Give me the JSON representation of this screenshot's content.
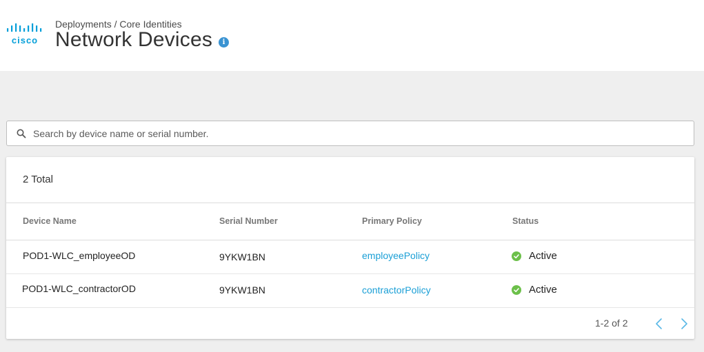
{
  "header": {
    "logo_text": "cisco",
    "breadcrumb": "Deployments / Core Identities",
    "title": "Network Devices",
    "info_glyph": "i"
  },
  "search": {
    "placeholder": "Search by device name or serial number.",
    "value": ""
  },
  "table": {
    "total_label": "2 Total",
    "columns": [
      "Device Name",
      "Serial Number",
      "Primary Policy",
      "Status"
    ],
    "rows": [
      {
        "device_name": "POD1-WLC_employeeOD",
        "serial_number": "9YKW1BN",
        "primary_policy": "employeePolicy",
        "status": "Active"
      },
      {
        "device_name": "POD1-WLC_contractorOD",
        "serial_number": "9YKW1BN",
        "primary_policy": "contractorPolicy",
        "status": "Active"
      }
    ]
  },
  "pagination": {
    "range_label": "1-2 of 2"
  },
  "colors": {
    "brand": "#049fd9",
    "link": "#1a9fd6",
    "status_active": "#6cc04a",
    "info": "#3a93d2"
  },
  "icons": {
    "logo": "cisco-logo-icon",
    "info": "info-icon",
    "search": "search-icon",
    "status": "check-circle-icon",
    "prev": "chevron-left-icon",
    "next": "chevron-right-icon"
  }
}
